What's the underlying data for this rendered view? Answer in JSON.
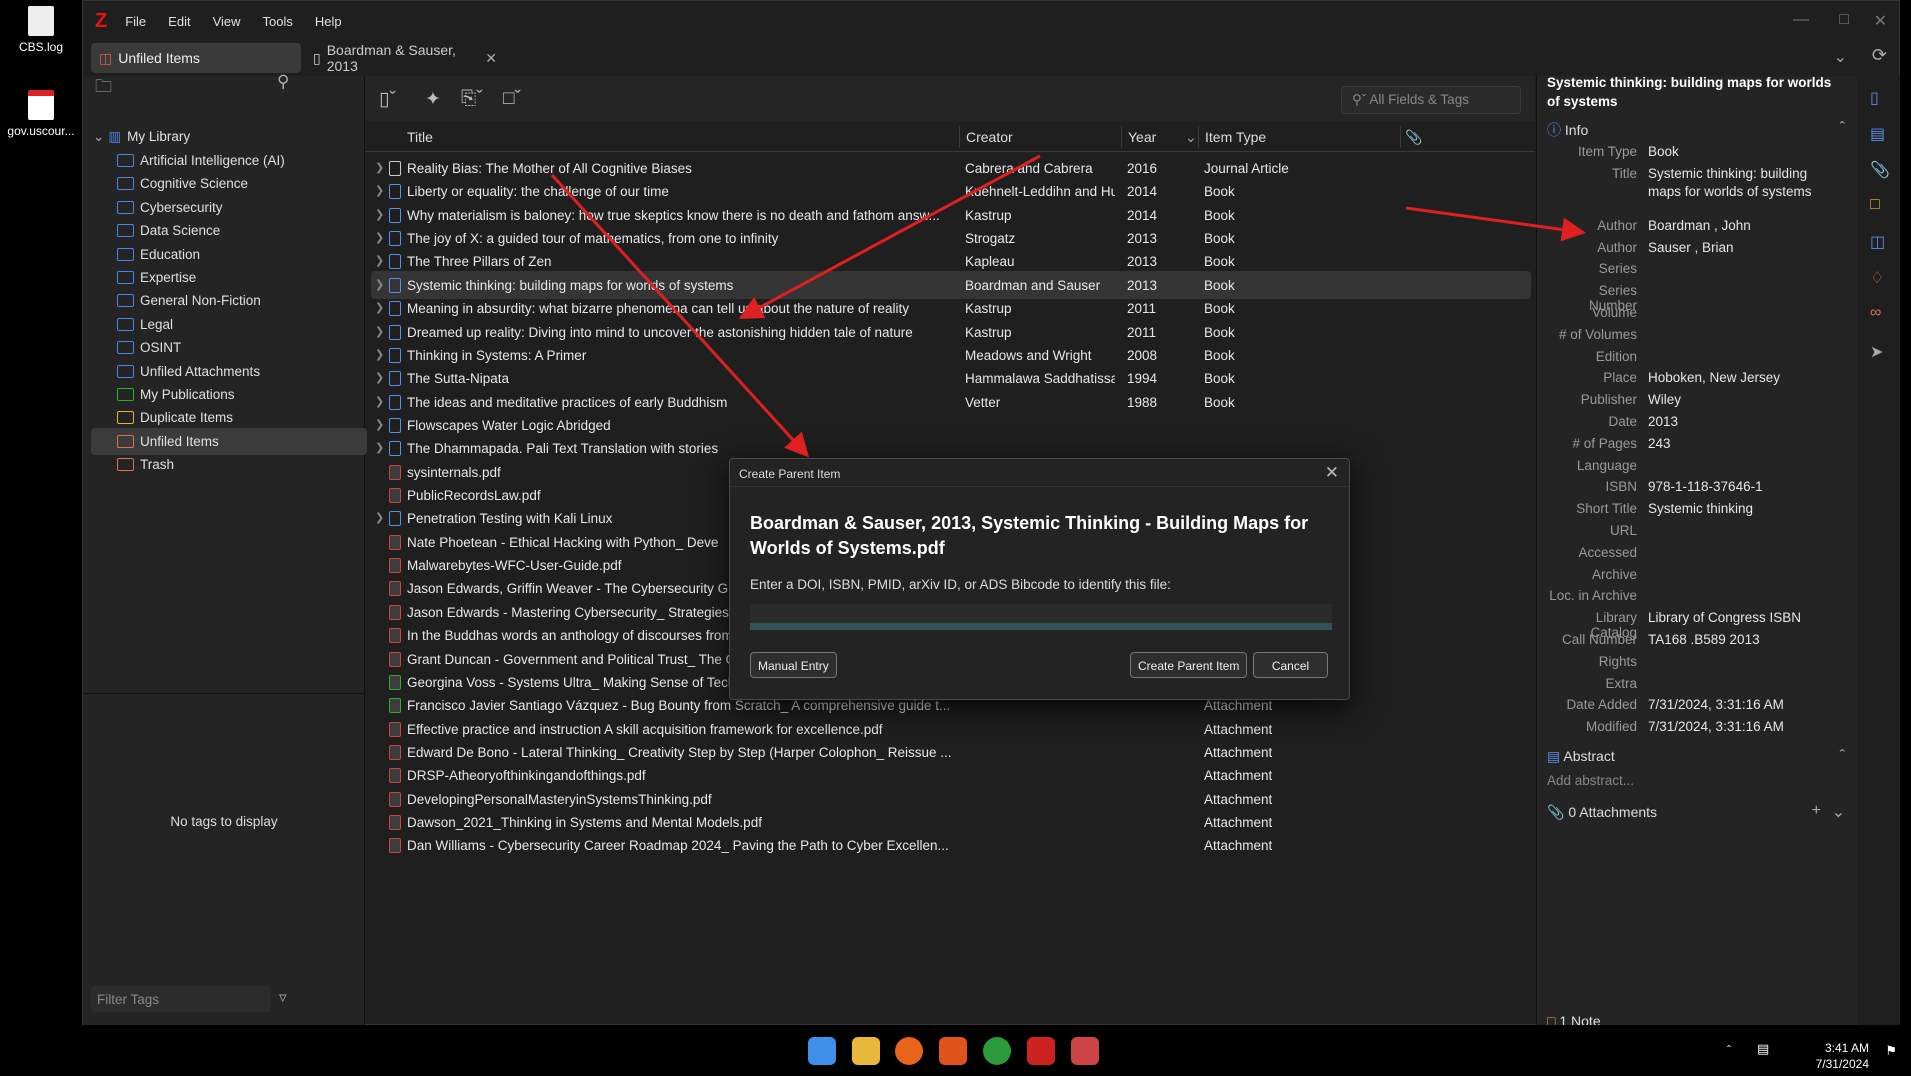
{
  "desktop": [
    {
      "label": "CBS.log"
    },
    {
      "label": "gov.uscour..."
    }
  ],
  "menus": [
    "File",
    "Edit",
    "View",
    "Tools",
    "Help"
  ],
  "tabs": {
    "library": "Unfiled Items",
    "item": "Boardman & Sauser, 2013"
  },
  "library": {
    "root": "My Library",
    "collections": [
      "Artificial Intelligence (AI)",
      "Cognitive Science",
      "Cybersecurity",
      "Data Science",
      "Education",
      "Expertise",
      "General Non-Fiction",
      "Legal",
      "OSINT"
    ],
    "special": [
      "Unfiled Attachments",
      "My Publications",
      "Duplicate Items",
      "Unfiled Items",
      "Trash"
    ]
  },
  "tags": {
    "empty": "No tags to display",
    "filter_placeholder": "Filter Tags"
  },
  "search": {
    "placeholder": "All Fields & Tags"
  },
  "columns": {
    "title": "Title",
    "creator": "Creator",
    "year": "Year",
    "type": "Item Type"
  },
  "rows": [
    {
      "t": "Reality Bias: The Mother of All Cognitive Biases",
      "c": "Cabrera and Cabrera",
      "y": "2016",
      "k": "Journal Article",
      "i": "doc",
      "a": "pdf",
      "x": true
    },
    {
      "t": "Liberty or equality: the challenge of our time",
      "c": "Kuehnelt-Leddihn and Hug...",
      "y": "2014",
      "k": "Book",
      "i": "book",
      "a": "epub",
      "x": true
    },
    {
      "t": "Why materialism is baloney: how true skeptics know there is no death and fathom answ...",
      "c": "Kastrup",
      "y": "2014",
      "k": "Book",
      "i": "book",
      "a": "pdf",
      "x": true
    },
    {
      "t": "The joy of X: a guided tour of mathematics, from one to infinity",
      "c": "Strogatz",
      "y": "2013",
      "k": "Book",
      "i": "book",
      "a": "pdf",
      "x": true
    },
    {
      "t": "The Three Pillars of Zen",
      "c": "Kapleau",
      "y": "2013",
      "k": "Book",
      "i": "book",
      "a": "epub",
      "x": true
    },
    {
      "t": "Systemic thinking: building maps for worlds of systems",
      "c": "Boardman and Sauser",
      "y": "2013",
      "k": "Book",
      "i": "book",
      "a": "",
      "x": true,
      "sel": true
    },
    {
      "t": "Meaning in absurdity: what bizarre phenomena can tell us about the nature of reality",
      "c": "Kastrup",
      "y": "2011",
      "k": "Book",
      "i": "book",
      "a": "pdf",
      "x": true
    },
    {
      "t": "Dreamed up reality: Diving into mind to uncover the astonishing hidden tale of nature",
      "c": "Kastrup",
      "y": "2011",
      "k": "Book",
      "i": "book",
      "a": "pdf",
      "x": true
    },
    {
      "t": "Thinking in Systems: A Primer",
      "c": "Meadows and Wright",
      "y": "2008",
      "k": "Book",
      "i": "book",
      "a": "epub",
      "x": true
    },
    {
      "t": "The Sutta-Nipata",
      "c": "Hammalawa Saddhatissa",
      "y": "1994",
      "k": "Book",
      "i": "book",
      "a": "pdf",
      "x": true
    },
    {
      "t": "The ideas and meditative practices of early Buddhism",
      "c": "Vetter",
      "y": "1988",
      "k": "Book",
      "i": "book",
      "a": "pdf",
      "x": true
    },
    {
      "t": "Flowscapes Water Logic Abridged",
      "c": "",
      "y": "",
      "k": "",
      "i": "book",
      "a": "pdf",
      "x": true
    },
    {
      "t": "The Dhammapada. Pali Text Translation with stories",
      "c": "",
      "y": "",
      "k": "",
      "i": "book",
      "a": "pdf",
      "x": true
    },
    {
      "t": "sysinternals.pdf",
      "c": "",
      "y": "",
      "k": "",
      "i": "pdf",
      "a": "pdf",
      "x": false
    },
    {
      "t": "PublicRecordsLaw.pdf",
      "c": "",
      "y": "",
      "k": "",
      "i": "pdf",
      "a": "pdf",
      "x": false
    },
    {
      "t": "Penetration Testing with Kali Linux",
      "c": "",
      "y": "",
      "k": "",
      "i": "book",
      "a": "pdf",
      "x": true
    },
    {
      "t": "Nate Phoetean - Ethical Hacking with Python_ Deve",
      "c": "",
      "y": "",
      "k": "",
      "i": "pdf",
      "a": "pdf",
      "x": false
    },
    {
      "t": "Malwarebytes-WFC-User-Guide.pdf",
      "c": "",
      "y": "",
      "k": "",
      "i": "pdf",
      "a": "pdf",
      "x": false
    },
    {
      "t": "Jason Edwards, Griffin Weaver - The Cybersecurity G",
      "c": "",
      "y": "",
      "k": "",
      "i": "pdf",
      "a": "pdf",
      "x": false
    },
    {
      "t": "Jason Edwards - Mastering Cybersecurity_ Strategies, Technologies, and Best Practices-...",
      "c": "",
      "y": "",
      "k": "Attachment",
      "i": "pdf",
      "a": "pdf",
      "x": false
    },
    {
      "t": "In the Buddhas words an anthology of discourses from the Pāli canon by Bhikkhu is Jeff...",
      "c": "",
      "y": "",
      "k": "Attachment",
      "i": "pdf",
      "a": "pdf",
      "x": false
    },
    {
      "t": "Grant Duncan - Government and Political Trust_ The Quest for Positive Public Administr...",
      "c": "",
      "y": "",
      "k": "Attachment",
      "i": "pdf",
      "a": "pdf",
      "x": false
    },
    {
      "t": "Georgina Voss - Systems Ultra_ Making Sense of Technology in a Complex World-Verso ...",
      "c": "",
      "y": "",
      "k": "Attachment",
      "i": "epub",
      "a": "epub",
      "x": false
    },
    {
      "t": "Francisco Javier Santiago Vázquez - Bug Bounty from Scratch_ A comprehensive guide t...",
      "c": "",
      "y": "",
      "k": "Attachment",
      "i": "epub",
      "a": "epub",
      "x": false
    },
    {
      "t": "Effective practice and instruction A skill acquisition framework for excellence.pdf",
      "c": "",
      "y": "",
      "k": "Attachment",
      "i": "pdf",
      "a": "pdf",
      "x": false
    },
    {
      "t": "Edward De Bono - Lateral Thinking_ Creativity Step by Step (Harper Colophon_ Reissue ...",
      "c": "",
      "y": "",
      "k": "Attachment",
      "i": "pdf",
      "a": "pdf",
      "x": false
    },
    {
      "t": "DRSP-Atheoryofthinkingandofthings.pdf",
      "c": "",
      "y": "",
      "k": "Attachment",
      "i": "pdf",
      "a": "pdf",
      "x": false
    },
    {
      "t": "DevelopingPersonalMasteryinSystemsThinking.pdf",
      "c": "",
      "y": "",
      "k": "Attachment",
      "i": "pdf",
      "a": "pdf",
      "x": false
    },
    {
      "t": "Dawson_2021_Thinking in Systems and Mental Models.pdf",
      "c": "",
      "y": "",
      "k": "Attachment",
      "i": "pdf",
      "a": "pdf",
      "x": false
    },
    {
      "t": "Dan Williams - Cybersecurity Career Roadmap 2024_ Paving the Path to Cyber Excellen...",
      "c": "",
      "y": "",
      "k": "Attachment",
      "i": "pdf",
      "a": "pdf",
      "x": false
    }
  ],
  "item": {
    "header": "Systemic thinking: building maps for worlds of systems",
    "info_label": "Info",
    "fields": [
      {
        "l": "Item Type",
        "v": "Book"
      },
      {
        "l": "Title",
        "v": "Systemic thinking: building maps for worlds of systems"
      },
      {
        "l": "Author",
        "v": "Boardman , John"
      },
      {
        "l": "Author",
        "v": "Sauser , Brian"
      },
      {
        "l": "Series",
        "v": ""
      },
      {
        "l": "Series Number",
        "v": ""
      },
      {
        "l": "Volume",
        "v": ""
      },
      {
        "l": "# of Volumes",
        "v": ""
      },
      {
        "l": "Edition",
        "v": ""
      },
      {
        "l": "Place",
        "v": "Hoboken, New Jersey"
      },
      {
        "l": "Publisher",
        "v": "Wiley"
      },
      {
        "l": "Date",
        "v": "2013"
      },
      {
        "l": "# of Pages",
        "v": "243"
      },
      {
        "l": "Language",
        "v": ""
      },
      {
        "l": "ISBN",
        "v": "978-1-118-37646-1"
      },
      {
        "l": "Short Title",
        "v": "Systemic thinking"
      },
      {
        "l": "URL",
        "v": ""
      },
      {
        "l": "Accessed",
        "v": ""
      },
      {
        "l": "Archive",
        "v": ""
      },
      {
        "l": "Loc. in Archive",
        "v": ""
      },
      {
        "l": "Library Catalog",
        "v": "Library of Congress ISBN"
      },
      {
        "l": "Call Number",
        "v": "TA168 .B589 2013"
      },
      {
        "l": "Rights",
        "v": ""
      },
      {
        "l": "Extra",
        "v": ""
      },
      {
        "l": "Date Added",
        "v": "7/31/2024, 3:31:16 AM"
      },
      {
        "l": "Modified",
        "v": "7/31/2024, 3:31:16 AM"
      }
    ],
    "abstract_label": "Abstract",
    "abstract_placeholder": "Add abstract...",
    "attachments_label": "0 Attachments",
    "notes_label": "1 Note"
  },
  "dialog": {
    "title": "Create Parent Item",
    "heading": "Boardman & Sauser, 2013, Systemic Thinking - Building Maps for Worlds of Systems.pdf",
    "prompt": "Enter a DOI, ISBN, PMID, arXiv ID, or ADS Bibcode to identify this file:",
    "input_value": "",
    "manual": "Manual Entry",
    "create": "Create Parent Item",
    "cancel": "Cancel"
  },
  "clock": {
    "time": "3:41 AM",
    "date": "7/31/2024"
  },
  "colors": {
    "accent": "#4a86e8",
    "annotation": "#e02020",
    "pdf": "#cc3333",
    "epub": "#33aa33"
  }
}
